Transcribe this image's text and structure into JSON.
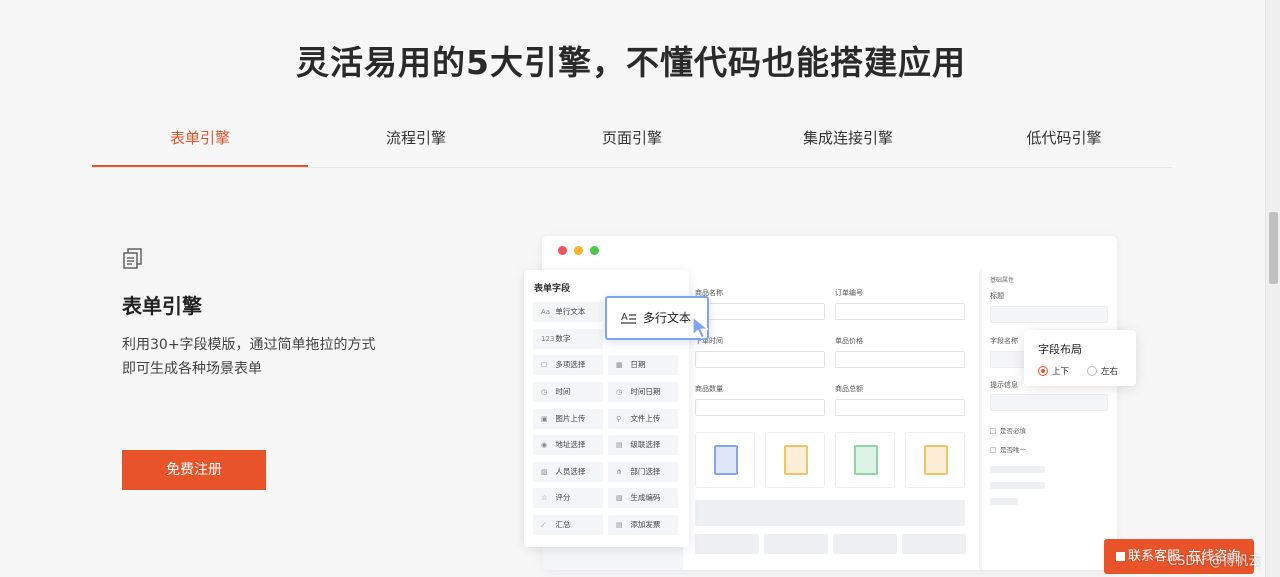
{
  "headline": "灵活易用的5大引擎，不懂代码也能搭建应用",
  "tabs": [
    {
      "label": "表单引擎",
      "active": true
    },
    {
      "label": "流程引擎",
      "active": false
    },
    {
      "label": "页面引擎",
      "active": false
    },
    {
      "label": "集成连接引擎",
      "active": false
    },
    {
      "label": "低代码引擎",
      "active": false
    }
  ],
  "feature": {
    "icon": "form-copy-icon",
    "title": "表单引擎",
    "desc_line1": "利用30+字段模版，通过简单拖拉的方式",
    "desc_line2": "即可生成各种场景表单",
    "button": "免费注册"
  },
  "mock": {
    "window_dots": [
      "#f0525a",
      "#f6b42c",
      "#4cc64b"
    ],
    "palette_title": "表单字段",
    "fields": [
      {
        "label": "单行文本",
        "icon": "Aa"
      },
      {
        "label": "数字",
        "icon": "123"
      },
      {
        "label": "多项选择",
        "icon": "☐"
      },
      {
        "label": "日期",
        "icon": "▦"
      },
      {
        "label": "时间",
        "icon": "◷"
      },
      {
        "label": "时间日期",
        "icon": "◷"
      },
      {
        "label": "图片上传",
        "icon": "▣"
      },
      {
        "label": "文件上传",
        "icon": "⚲"
      },
      {
        "label": "地址选择",
        "icon": "◉"
      },
      {
        "label": "级联选择",
        "icon": "▤"
      },
      {
        "label": "人员选择",
        "icon": "▨"
      },
      {
        "label": "部门选择",
        "icon": "⋔"
      },
      {
        "label": "评分",
        "icon": "☆"
      },
      {
        "label": "生成编码",
        "icon": "▧"
      },
      {
        "label": "汇总",
        "icon": "⟋"
      },
      {
        "label": "添加发票",
        "icon": "▤"
      }
    ],
    "drag_card": "多行文本",
    "canvas_labels": {
      "product_name": "商品名称",
      "order_no": "订单编号",
      "order_time": "下单时间",
      "unit_price": "单品价格",
      "quantity": "商品数量",
      "total": "商品总额"
    },
    "thumb_colors": [
      "#5b7fe0",
      "#f2b13b",
      "#4cbb7a",
      "#f2b13b"
    ],
    "props": {
      "section": "基础属性",
      "title_label": "标题",
      "field_name_label": "字段名称",
      "hint_label": "提示信息",
      "required": "是否必填",
      "unique": "是否唯一"
    },
    "layout_popup": {
      "title": "字段布局",
      "option1": "上下",
      "option2": "左右",
      "selected": "上下"
    }
  },
  "contact": {
    "label1": "联系客服",
    "label2": "在线咨询"
  },
  "watermark": "CSDN @得帆云",
  "accent_color": "#e8532a"
}
